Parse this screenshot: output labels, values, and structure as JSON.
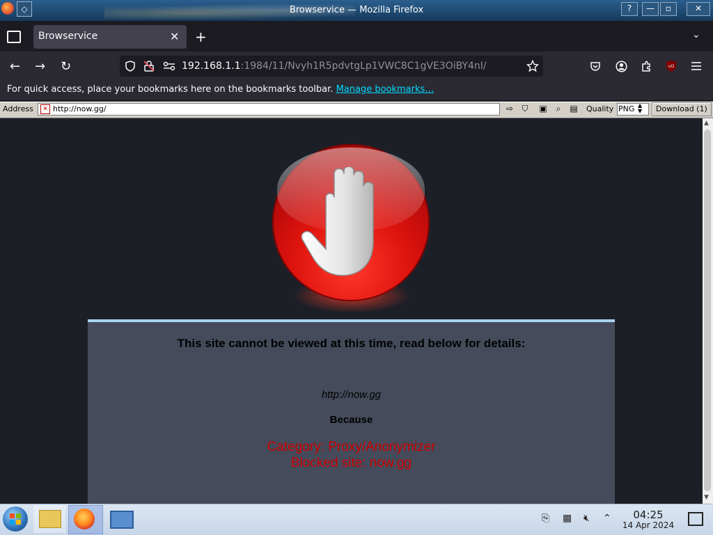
{
  "window": {
    "title": "Browservice — Mozilla Firefox",
    "controls": {
      "help": "?",
      "minimize": "—",
      "maximize": "▫",
      "close": "✕"
    }
  },
  "tabs": [
    {
      "label": "Browservice",
      "active": true
    }
  ],
  "tab_controls": {
    "close": "✕",
    "new": "+",
    "list": "⌄"
  },
  "navbar": {
    "back": "←",
    "forward": "→",
    "reload": "↻",
    "url_host": "192.168.1.1",
    "url_path": ":1984/11/Nvyh1R5pdvtgLp1VWC8C1gVE3OiBY4nI/",
    "icons": [
      "shield-icon",
      "lock-slash-icon",
      "permissions-icon",
      "star-icon",
      "pocket-icon",
      "account-icon",
      "extensions-icon",
      "ublock-icon",
      "menu-icon"
    ]
  },
  "bookmarks_bar": {
    "message": "For quick access, place your bookmarks here on the bookmarks toolbar. ",
    "link": "Manage bookmarks…"
  },
  "browservice_toolbar": {
    "address_label": "Address",
    "address_value": "http://now.gg/",
    "quality_label": "Quality",
    "quality_value": "PNG",
    "download_label": "Download (1)"
  },
  "block_page": {
    "heading": "This site cannot be viewed at this time, read below for details:",
    "url": "http://now.gg",
    "because": "Because",
    "category": "Category: Proxy/Anonymizer",
    "blocked_site": "Blocked site: now.gg"
  },
  "taskbar": {
    "clock_time": "04:25",
    "clock_date": "14 Apr 2024",
    "apps": [
      "file-manager-icon",
      "firefox-icon",
      "network-settings-icon"
    ]
  },
  "colors": {
    "accent": "#a9d3f0",
    "block_text": "#cc0000",
    "panel": "#454b5a",
    "content_bg": "#1d1f27"
  }
}
